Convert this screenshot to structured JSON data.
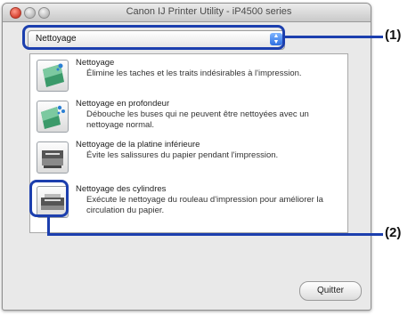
{
  "window": {
    "title": "Canon IJ Printer Utility - iP4500 series"
  },
  "select": {
    "value": "Nettoyage"
  },
  "items": [
    {
      "title": "Nettoyage",
      "desc": "Élimine les taches et les traits indésirables à l'impression.",
      "icon": "cleaning-icon"
    },
    {
      "title": "Nettoyage en profondeur",
      "desc": "Débouche les buses qui ne peuvent être nettoyées avec un nettoyage normal.",
      "icon": "deep-cleaning-icon"
    },
    {
      "title": "Nettoyage de la platine inférieure",
      "desc": "Évite les salissures du papier pendant l'impression.",
      "icon": "bottom-plate-cleaning-icon"
    },
    {
      "title": "Nettoyage des cylindres",
      "desc": "Exécute le nettoyage du rouleau d'impression pour améliorer la circulation du papier.",
      "icon": "roller-cleaning-icon"
    }
  ],
  "buttons": {
    "quit": "Quitter"
  },
  "callouts": {
    "one": "(1)",
    "two": "(2)"
  },
  "colors": {
    "callout": "#1c3fae",
    "window_bg": "#e9e9e9",
    "select_arrow": "#2d6fe0"
  }
}
